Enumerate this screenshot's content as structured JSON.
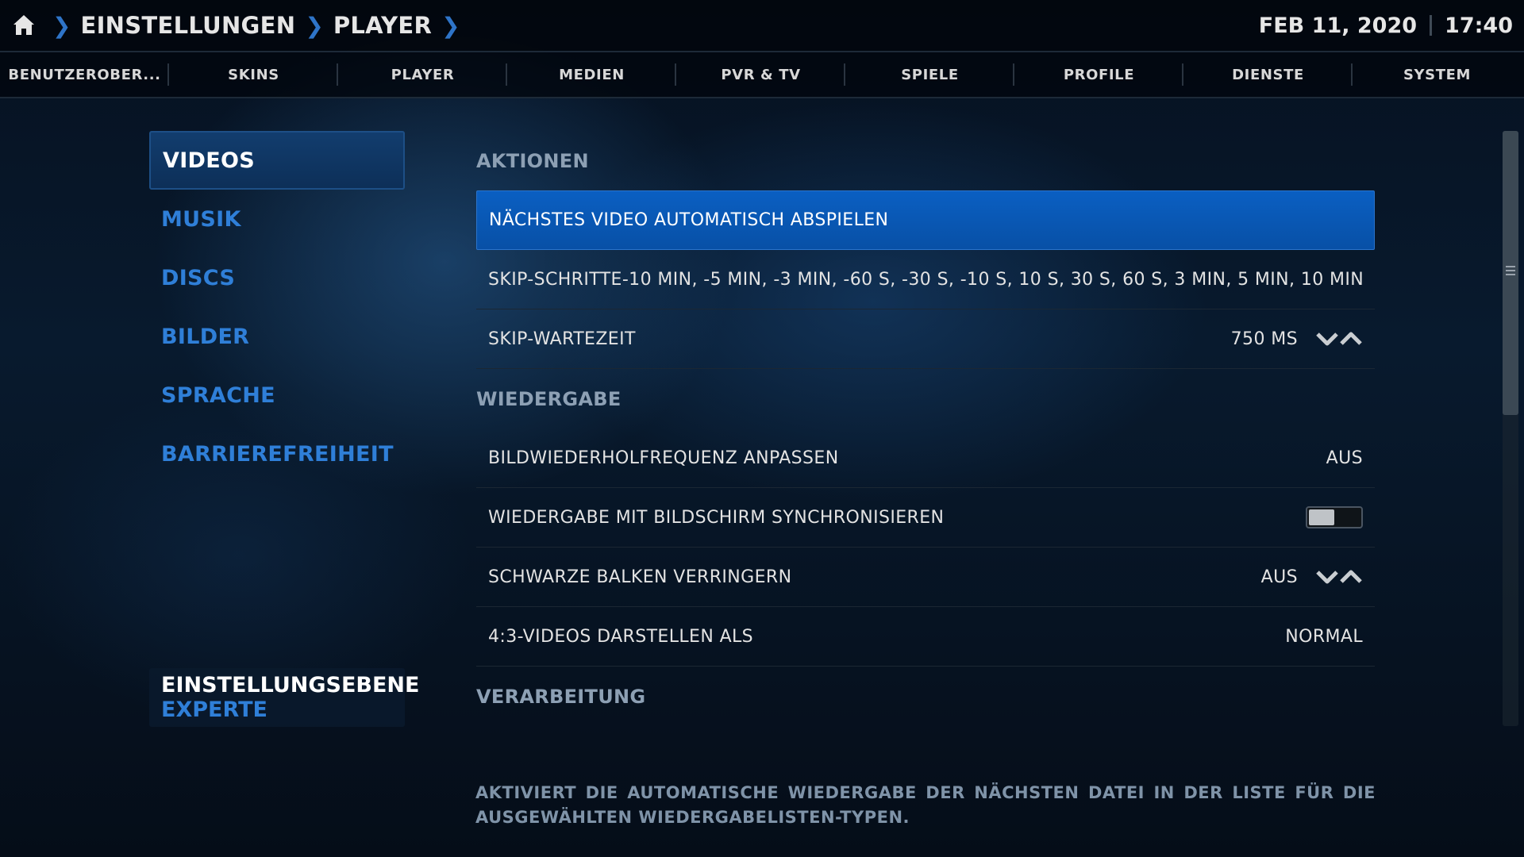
{
  "header": {
    "breadcrumbs": [
      "EINSTELLUNGEN",
      "PLAYER"
    ],
    "date": "FEB 11, 2020",
    "time": "17:40"
  },
  "tabs": [
    "BENUTZEROBER...",
    "SKINS",
    "PLAYER",
    "MEDIEN",
    "PVR & TV",
    "SPIELE",
    "PROFILE",
    "DIENSTE",
    "SYSTEM"
  ],
  "categories": [
    "VIDEOS",
    "MUSIK",
    "DISCS",
    "BILDER",
    "SPRACHE",
    "BARRIEREFREIHEIT"
  ],
  "settings_level": {
    "title": "EINSTELLUNGSEBENE",
    "value": "EXPERTE"
  },
  "sections": {
    "aktionen": "AKTIONEN",
    "wiedergabe": "WIEDERGABE",
    "verarbeitung": "VERARBEITUNG"
  },
  "settings": {
    "next_video": {
      "label": "NÄCHSTES VIDEO AUTOMATISCH ABSPIELEN"
    },
    "skip_steps": {
      "label": "SKIP-SCHRITTE",
      "value": "-10 MIN, -5 MIN, -3 MIN, -60 S, -30 S, -10 S, 10 S, 30 S, 60 S, 3 MIN, 5 MIN, 10 MIN"
    },
    "skip_delay": {
      "label": "SKIP-WARTEZEIT",
      "value": "750 MS"
    },
    "refresh_rate": {
      "label": "BILDWIEDERHOLFREQUENZ ANPASSEN",
      "value": "AUS"
    },
    "sync_display": {
      "label": "WIEDERGABE MIT BILDSCHIRM SYNCHRONISIEREN",
      "enabled": false
    },
    "black_bars": {
      "label": "SCHWARZE BALKEN VERRINGERN",
      "value": "AUS"
    },
    "display_43": {
      "label": "4:3-VIDEOS DARSTELLEN ALS",
      "value": "NORMAL"
    }
  },
  "description": "AKTIVIERT DIE AUTOMATISCHE WIEDERGABE DER NÄCHSTEN DATEI IN DER LISTE FÜR DIE AUSGEWÄHLTEN WIEDERGABELISTEN-TYPEN.",
  "colors": {
    "accent": "#2f7fd8",
    "focus": "#0a5fc2",
    "section": "#8da0b4"
  },
  "selected_category": "VIDEOS"
}
